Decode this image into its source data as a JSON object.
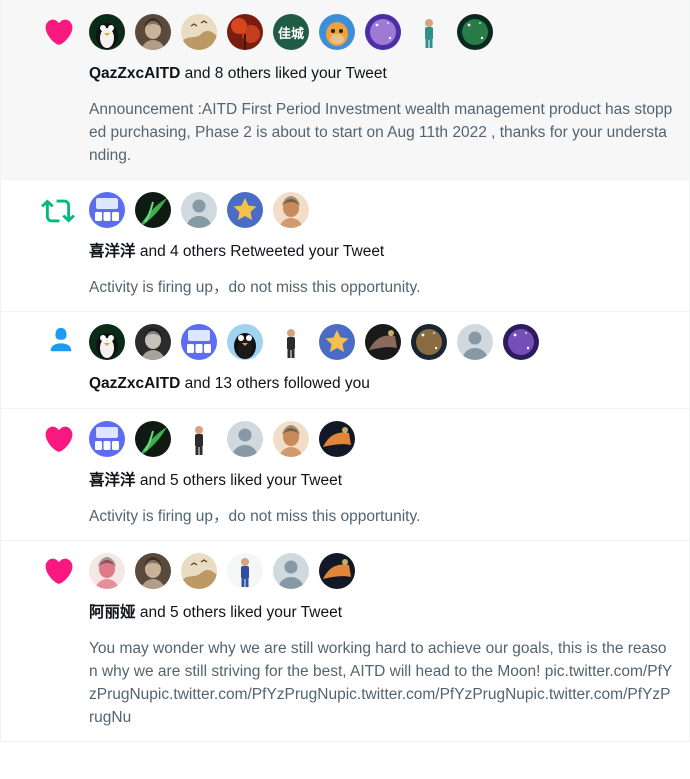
{
  "notifications": [
    {
      "type": "like",
      "icon": "heart-icon",
      "icon_color": "#f91880",
      "highlighted": true,
      "actor": "QazZxcAITD",
      "summary_rest": " and 8 others liked your Tweet",
      "text": "Announcement :AITD First Period Investment wealth management product has stopped purchasing, Phase 2 is about to start on Aug 11th 2022 , thanks for your understanding.",
      "avatars": [
        {
          "name": "avatar-penguin-glasses",
          "colors": [
            "#0b2a18",
            "#f2f2f2"
          ]
        },
        {
          "name": "avatar-man-portrait",
          "colors": [
            "#5a4a3c",
            "#c9b29a"
          ]
        },
        {
          "name": "avatar-painting-birds",
          "colors": [
            "#e9dcc2",
            "#a87c3d"
          ]
        },
        {
          "name": "avatar-red-foliage",
          "colors": [
            "#7a1d10",
            "#d8461f"
          ]
        },
        {
          "name": "avatar-text-jiacheng",
          "colors": [
            "#1f5c45",
            "#ffffff"
          ],
          "label": "佳城"
        },
        {
          "name": "avatar-orange-ape",
          "colors": [
            "#3f8fd8",
            "#f0a23a"
          ]
        },
        {
          "name": "avatar-purple-galaxy",
          "colors": [
            "#4b2fa5",
            "#e3b6ff"
          ]
        },
        {
          "name": "avatar-dancer-white",
          "colors": [
            "#f4f7f6",
            "#2f8f8a"
          ]
        },
        {
          "name": "avatar-green-nebula",
          "colors": [
            "#0a2a1e",
            "#3fbf6a"
          ]
        }
      ]
    },
    {
      "type": "retweet",
      "icon": "retweet-icon",
      "icon_color": "#00ba7c",
      "highlighted": false,
      "actor": "喜洋洋",
      "summary_rest": " and 4 others Retweeted your Tweet",
      "text": "Activity is firing up，do not miss this opportunity.",
      "avatars": [
        {
          "name": "avatar-app-screen",
          "colors": [
            "#5c6df2",
            "#dfe6ff"
          ]
        },
        {
          "name": "avatar-green-leaf",
          "colors": [
            "#0f1a12",
            "#3bb054"
          ]
        },
        {
          "name": "avatar-default",
          "colors": [
            "#cfd9de",
            "#ffffff"
          ]
        },
        {
          "name": "avatar-cartoon-star",
          "colors": [
            "#4a6cc7",
            "#f5c04a"
          ]
        },
        {
          "name": "avatar-blonde-girl",
          "colors": [
            "#f2ddc8",
            "#c88a59"
          ]
        }
      ]
    },
    {
      "type": "follow",
      "icon": "person-icon",
      "icon_color": "#1d9bf0",
      "highlighted": false,
      "actor": "QazZxcAITD",
      "summary_rest": " and 13 others followed you",
      "text": "",
      "avatars": [
        {
          "name": "avatar-penguin-glasses",
          "colors": [
            "#0b2a18",
            "#f2f2f2"
          ]
        },
        {
          "name": "avatar-sketch-face",
          "colors": [
            "#2b2b2b",
            "#c7c2b9"
          ]
        },
        {
          "name": "avatar-app-screen",
          "colors": [
            "#5c6df2",
            "#dfe6ff"
          ]
        },
        {
          "name": "avatar-penguin-cartoon",
          "colors": [
            "#9fd3f0",
            "#1b1b1b"
          ]
        },
        {
          "name": "avatar-man-suit",
          "colors": [
            "#ffffff",
            "#2b2b2b"
          ]
        },
        {
          "name": "avatar-cartoon-star",
          "colors": [
            "#4a6cc7",
            "#f5c04a"
          ]
        },
        {
          "name": "avatar-dark-sneaker",
          "colors": [
            "#1a1a1a",
            "#8b6a5c"
          ]
        },
        {
          "name": "avatar-night-city",
          "colors": [
            "#1a2433",
            "#e6a84a"
          ]
        },
        {
          "name": "avatar-default",
          "colors": [
            "#cfd9de",
            "#ffffff"
          ]
        },
        {
          "name": "avatar-purple-stage",
          "colors": [
            "#2c1b5e",
            "#b07cff"
          ]
        }
      ]
    },
    {
      "type": "like",
      "icon": "heart-icon",
      "icon_color": "#f91880",
      "highlighted": false,
      "actor": "喜洋洋",
      "summary_rest": " and 5 others liked your Tweet",
      "text": "Activity is firing up，do not miss this opportunity.",
      "avatars": [
        {
          "name": "avatar-app-screen",
          "colors": [
            "#5c6df2",
            "#dfe6ff"
          ]
        },
        {
          "name": "avatar-green-leaf",
          "colors": [
            "#0f1a12",
            "#3bb054"
          ]
        },
        {
          "name": "avatar-man-suit",
          "colors": [
            "#ffffff",
            "#2b2b2b"
          ]
        },
        {
          "name": "avatar-default",
          "colors": [
            "#cfd9de",
            "#ffffff"
          ]
        },
        {
          "name": "avatar-blonde-girl",
          "colors": [
            "#f2ddc8",
            "#c88a59"
          ]
        },
        {
          "name": "avatar-game-art",
          "colors": [
            "#121826",
            "#e2843a"
          ]
        }
      ]
    },
    {
      "type": "like",
      "icon": "heart-icon",
      "icon_color": "#f91880",
      "highlighted": false,
      "actor": "阿丽娅",
      "summary_rest": " and 5 others liked your Tweet",
      "text": "You may wonder why we are still working hard to achieve our goals, this is the reason why we are still striving for the best, AITD will head to the Moon! pic.twitter.com/PfYzPrugNupic.twitter.com/PfYzPrugNupic.twitter.com/PfYzPrugNupic.twitter.com/PfYzPrugNu",
      "avatars": [
        {
          "name": "avatar-girl-flowers",
          "colors": [
            "#f6e7e7",
            "#e07a8a"
          ]
        },
        {
          "name": "avatar-man-portrait",
          "colors": [
            "#5a4a3c",
            "#c9b29a"
          ]
        },
        {
          "name": "avatar-painting-birds",
          "colors": [
            "#e9dcc2",
            "#a87c3d"
          ]
        },
        {
          "name": "avatar-dancer-white",
          "colors": [
            "#f4f7f6",
            "#2f4fa0"
          ]
        },
        {
          "name": "avatar-default",
          "colors": [
            "#cfd9de",
            "#ffffff"
          ]
        },
        {
          "name": "avatar-game-art",
          "colors": [
            "#121826",
            "#e2843a"
          ]
        }
      ]
    }
  ]
}
